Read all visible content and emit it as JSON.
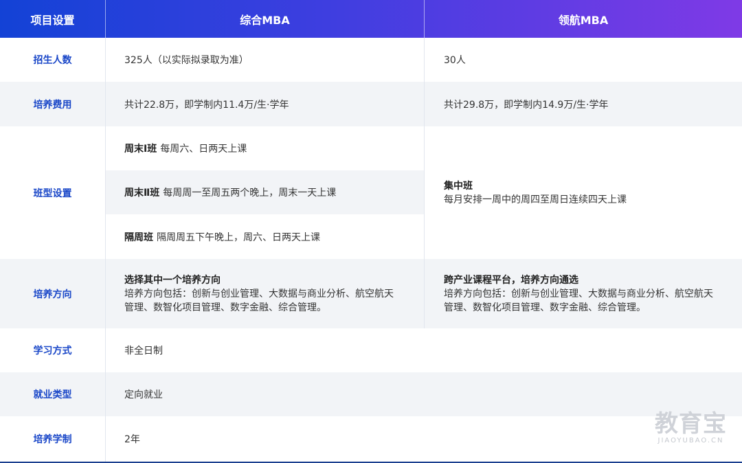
{
  "header": {
    "col1": "项目设置",
    "col2": "综合MBA",
    "col3": "领航MBA"
  },
  "rows": {
    "enrollment": {
      "label": "招生人数",
      "mba": "325人（以实际拟录取为准）",
      "pilot": "30人"
    },
    "fees": {
      "label": "培养费用",
      "mba": "共计22.8万，即学制内11.4万/生·学年",
      "pilot": "共计29.8万，即学制内14.9万/生·学年"
    },
    "classes": {
      "label": "班型设置",
      "mba": [
        {
          "name": "周末Ⅰ班",
          "desc": "每周六、日两天上课"
        },
        {
          "name": "周末Ⅱ班",
          "desc": "每周周一至周五两个晚上，周末一天上课"
        },
        {
          "name": "隔周班",
          "desc": "隔周周五下午晚上，周六、日两天上课"
        }
      ],
      "pilot": {
        "name": "集中班",
        "desc": "每月安排一周中的周四至周日连续四天上课"
      }
    },
    "direction": {
      "label": "培养方向",
      "mba": {
        "title": "选择其中一个培养方向",
        "line1": "培养方向包括：创新与创业管理、大数据与商业分析、航空航天",
        "line2": "管理、数智化项目管理、数字金融、综合管理。"
      },
      "pilot": {
        "title": "跨产业课程平台，培养方向通选",
        "line1": "培养方向包括：创新与创业管理、大数据与商业分析、航空航天",
        "line2": "管理、数智化项目管理、数字金融、综合管理。"
      }
    },
    "study_mode": {
      "label": "学习方式",
      "value": "非全日制"
    },
    "employment": {
      "label": "就业类型",
      "value": "定向就业"
    },
    "duration": {
      "label": "培养学制",
      "value": "2年"
    }
  },
  "watermark": {
    "main": "教育宝",
    "sub": "JIAOYUBAO.CN"
  },
  "colors": {
    "header_start": "#1342d6",
    "header_end": "#7f3ae6",
    "label_text": "#1a47c8",
    "alt_row": "#f2f4f7"
  }
}
